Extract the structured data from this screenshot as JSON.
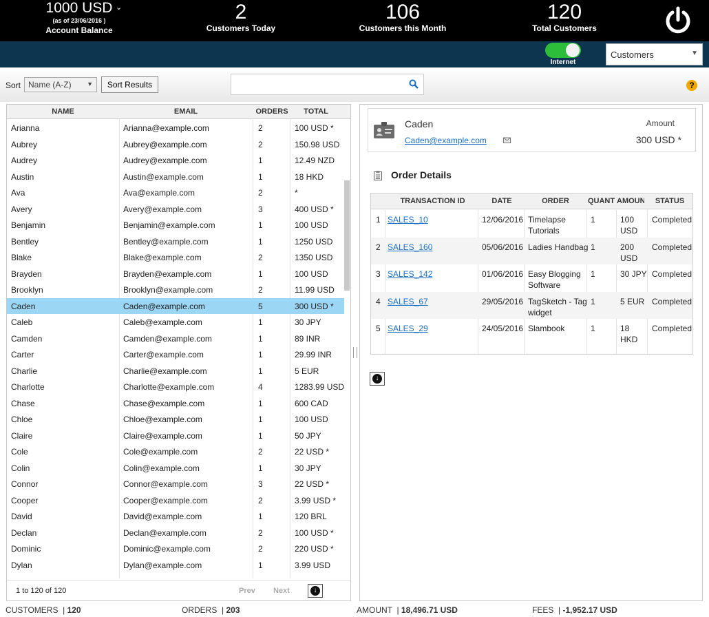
{
  "header": {
    "balance": {
      "amount": "1000 USD",
      "as_of": "(as of 23/06/2016 )",
      "label": "Account Balance"
    },
    "today": {
      "value": "2",
      "label": "Customers Today"
    },
    "month": {
      "value": "106",
      "label": "Customers this Month"
    },
    "total": {
      "value": "120",
      "label": "Total Customers"
    }
  },
  "nav": {
    "internet_label": "Internet",
    "view_select": "Customers"
  },
  "toolbar": {
    "sort_label": "Sort",
    "sort_value": "Name (A-Z)",
    "sort_button": "Sort Results",
    "search_placeholder": ""
  },
  "list": {
    "columns": {
      "name": "NAME",
      "email": "EMAIL",
      "orders": "ORDERS",
      "total": "TOTAL"
    },
    "rows": [
      {
        "name": "Arianna",
        "email": "Arianna@example.com",
        "orders": "2",
        "total": "100 USD *"
      },
      {
        "name": "Aubrey",
        "email": "Aubrey@example.com",
        "orders": "2",
        "total": "150.98 USD"
      },
      {
        "name": "Audrey",
        "email": "Audrey@example.com",
        "orders": "1",
        "total": "12.49 NZD"
      },
      {
        "name": "Austin",
        "email": "Austin@example.com",
        "orders": "1",
        "total": "18 HKD"
      },
      {
        "name": "Ava",
        "email": "Ava@example.com",
        "orders": "2",
        "total": "*"
      },
      {
        "name": "Avery",
        "email": "Avery@example.com",
        "orders": "3",
        "total": "400 USD *"
      },
      {
        "name": "Benjamin",
        "email": "Benjamin@example.com",
        "orders": "1",
        "total": "100 USD"
      },
      {
        "name": "Bentley",
        "email": "Bentley@example.com",
        "orders": "1",
        "total": "1250 USD"
      },
      {
        "name": "Blake",
        "email": "Blake@example.com",
        "orders": "2",
        "total": "1350 USD"
      },
      {
        "name": "Brayden",
        "email": "Brayden@example.com",
        "orders": "1",
        "total": "100 USD"
      },
      {
        "name": "Brooklyn",
        "email": "Brooklyn@example.com",
        "orders": "2",
        "total": "11.99 USD"
      },
      {
        "name": "Caden",
        "email": "Caden@example.com",
        "orders": "5",
        "total": "300 USD *",
        "selected": true
      },
      {
        "name": "Caleb",
        "email": "Caleb@example.com",
        "orders": "1",
        "total": "30 JPY"
      },
      {
        "name": "Camden",
        "email": "Camden@example.com",
        "orders": "1",
        "total": "89 INR"
      },
      {
        "name": "Carter",
        "email": "Carter@example.com",
        "orders": "1",
        "total": "29.99 INR"
      },
      {
        "name": "Charlie",
        "email": "Charlie@example.com",
        "orders": "1",
        "total": "5 EUR"
      },
      {
        "name": "Charlotte",
        "email": "Charlotte@example.com",
        "orders": "4",
        "total": "1283.99 USD"
      },
      {
        "name": "Chase",
        "email": "Chase@example.com",
        "orders": "1",
        "total": "600 CAD"
      },
      {
        "name": "Chloe",
        "email": "Chloe@example.com",
        "orders": "1",
        "total": "100 USD"
      },
      {
        "name": "Claire",
        "email": "Claire@example.com",
        "orders": "1",
        "total": "50 JPY"
      },
      {
        "name": "Cole",
        "email": "Cole@example.com",
        "orders": "2",
        "total": "22 USD *"
      },
      {
        "name": "Colin",
        "email": "Colin@example.com",
        "orders": "1",
        "total": "30 JPY"
      },
      {
        "name": "Connor",
        "email": "Connor@example.com",
        "orders": "3",
        "total": "22 USD *"
      },
      {
        "name": "Cooper",
        "email": "Cooper@example.com",
        "orders": "2",
        "total": "3.99 USD *"
      },
      {
        "name": "David",
        "email": "David@example.com",
        "orders": "1",
        "total": "120 BRL"
      },
      {
        "name": "Declan",
        "email": "Declan@example.com",
        "orders": "2",
        "total": "100 USD *"
      },
      {
        "name": "Dominic",
        "email": "Dominic@example.com",
        "orders": "2",
        "total": "220 USD *"
      },
      {
        "name": "Dylan",
        "email": "Dylan@example.com",
        "orders": "1",
        "total": "3.99 USD"
      }
    ],
    "page_info": "1 to 120 of 120",
    "prev": "Prev",
    "next": "Next"
  },
  "customer": {
    "name": "Caden",
    "email": "Caden@example.com",
    "amount_label": "Amount",
    "amount": "300 USD *"
  },
  "orders": {
    "title": "Order Details",
    "columns": {
      "txn": "TRANSACTION ID",
      "date": "DATE",
      "order": "ORDER",
      "qty": "QUANT",
      "amount": "AMOUN",
      "status": "STATUS"
    },
    "rows": [
      {
        "num": "1",
        "txn": "SALES_10",
        "date": "12/06/2016",
        "order": "Timelapse Tutorials",
        "qty": "1",
        "amount": "100 USD",
        "status": "Completed"
      },
      {
        "num": "2",
        "txn": "SALES_160",
        "date": "05/06/2016",
        "order": "Ladies Handbag",
        "qty": "1",
        "amount": "200 USD",
        "status": "Completed"
      },
      {
        "num": "3",
        "txn": "SALES_142",
        "date": "01/06/2016",
        "order": "Easy Blogging Software",
        "qty": "1",
        "amount": "30 JPY",
        "status": "Completed"
      },
      {
        "num": "4",
        "txn": "SALES_67",
        "date": "29/05/2016",
        "order": "TagSketch - Tag widget",
        "qty": "1",
        "amount": "5 EUR",
        "status": "Completed"
      },
      {
        "num": "5",
        "txn": "SALES_29",
        "date": "24/05/2016",
        "order": "Slambook",
        "qty": "1",
        "amount": "18 HKD",
        "status": "Completed"
      }
    ]
  },
  "footer": {
    "customers_label": "CUSTOMERS",
    "customers_value": "120",
    "orders_label": "ORDERS",
    "orders_value": "203",
    "amount_label": "AMOUNT",
    "amount_value": "18,496.71 USD",
    "fees_label": "FEES",
    "fees_value": "-1,952.17 USD"
  },
  "colors": {
    "accent": "#9bd6f5",
    "navy": "#0e3550",
    "toggle_on": "#2ebd3a",
    "link": "#1a6fc4"
  },
  "icons": [
    "chevron-down-icon",
    "power-icon",
    "search-icon",
    "help-icon",
    "download-icon",
    "contact-card-icon",
    "mail-icon",
    "clipboard-icon"
  ]
}
